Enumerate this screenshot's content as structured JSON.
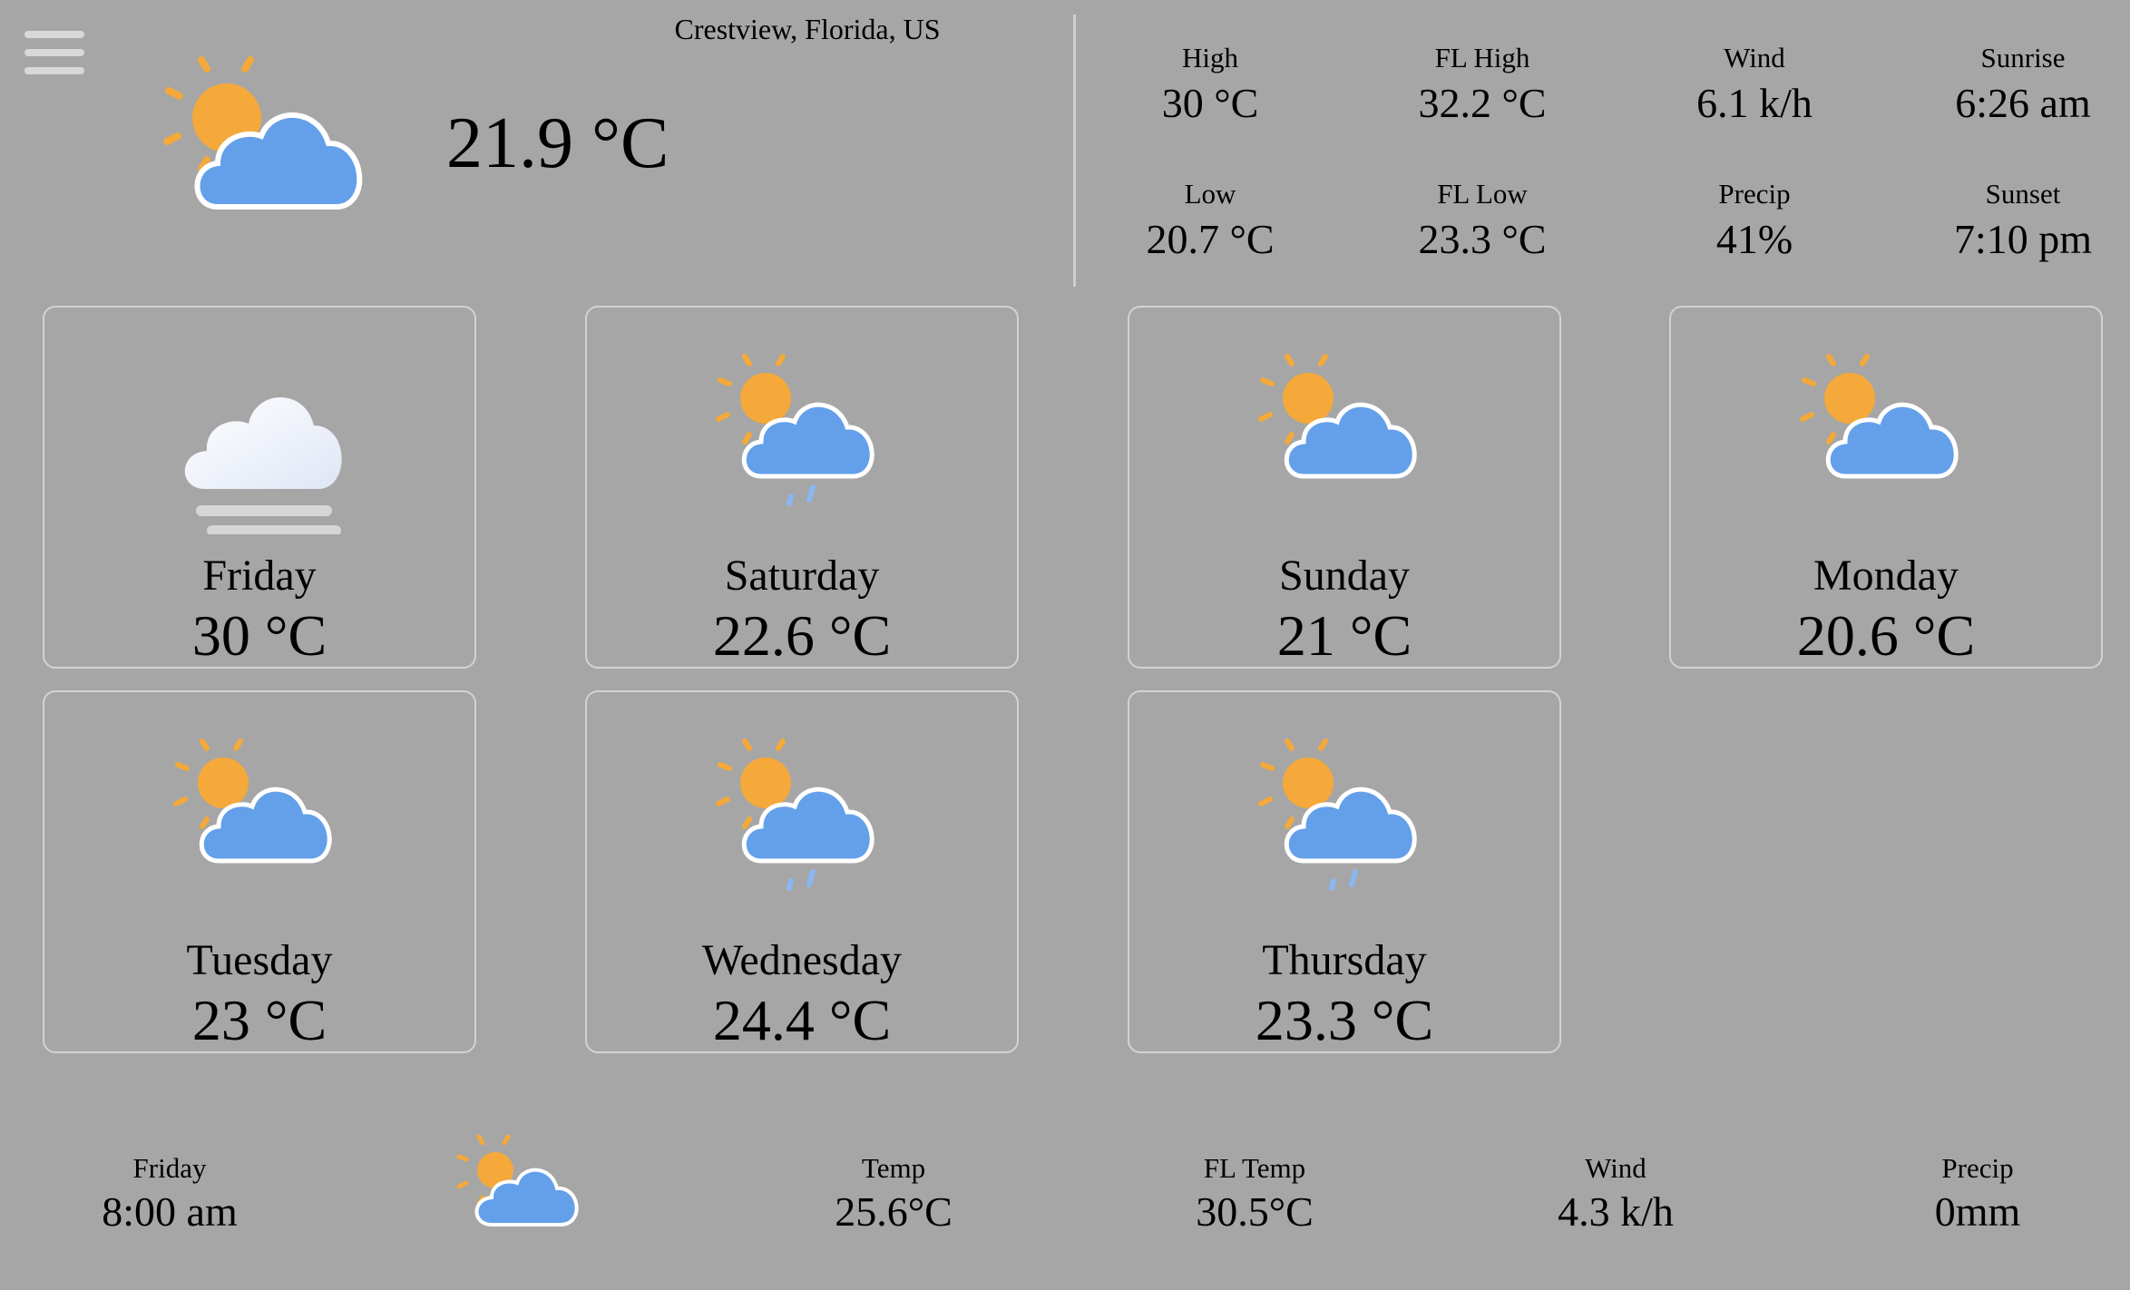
{
  "location": "Crestview, Florida, US",
  "current": {
    "temp": "21.9 °C",
    "icon": "partly-cloudy-icon"
  },
  "stats": {
    "high": {
      "label": "High",
      "value": "30 °C"
    },
    "fl_high": {
      "label": "FL High",
      "value": "32.2 °C"
    },
    "wind": {
      "label": "Wind",
      "value": "6.1 k/h"
    },
    "sunrise": {
      "label": "Sunrise",
      "value": "6:26 am"
    },
    "low": {
      "label": "Low",
      "value": "20.7 °C"
    },
    "fl_low": {
      "label": "FL Low",
      "value": "23.3 °C"
    },
    "precip": {
      "label": "Precip",
      "value": "41%"
    },
    "sunset": {
      "label": "Sunset",
      "value": "7:10 pm"
    }
  },
  "days": [
    {
      "name": "Friday",
      "temp": "30 °C",
      "icon": "fog-icon"
    },
    {
      "name": "Saturday",
      "temp": "22.6 °C",
      "icon": "partly-cloudy-rain-icon"
    },
    {
      "name": "Sunday",
      "temp": "21 °C",
      "icon": "partly-cloudy-icon"
    },
    {
      "name": "Monday",
      "temp": "20.6 °C",
      "icon": "partly-cloudy-icon"
    },
    {
      "name": "Tuesday",
      "temp": "23 °C",
      "icon": "partly-cloudy-icon"
    },
    {
      "name": "Wednesday",
      "temp": "24.4 °C",
      "icon": "partly-cloudy-rain-icon"
    },
    {
      "name": "Thursday",
      "temp": "23.3 °C",
      "icon": "partly-cloudy-rain-icon"
    }
  ],
  "hourly": {
    "day": "Friday",
    "time": "8:00 am",
    "icon": "partly-cloudy-icon",
    "temp": {
      "label": "Temp",
      "value": "25.6°C"
    },
    "fl_temp": {
      "label": "FL Temp",
      "value": "30.5°C"
    },
    "wind": {
      "label": "Wind",
      "value": "4.3 k/h"
    },
    "precip": {
      "label": "Precip",
      "value": "0mm"
    }
  },
  "colors": {
    "background": "#a6a6a6",
    "sun": "#f4a93a",
    "cloud": "#64a0ea",
    "rain": "#8ab7f0"
  }
}
